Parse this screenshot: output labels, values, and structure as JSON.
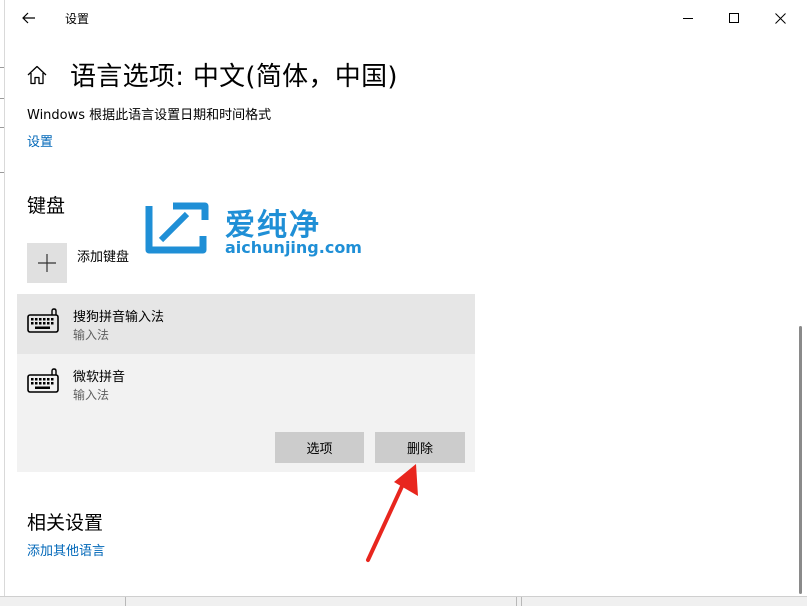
{
  "window": {
    "title": "设置",
    "accent_color": "#0067b8",
    "controls": [
      "minimize-icon",
      "maximize-icon",
      "close-icon"
    ]
  },
  "header": {
    "title": "语言选项: 中文(简体，中国)"
  },
  "region": {
    "description": "Windows 根据此语言设置日期和时间格式",
    "settings_link": "设置"
  },
  "keyboard": {
    "section_title": "键盘",
    "add_label": "添加键盘",
    "items": [
      {
        "name": "搜狗拼音输入法",
        "type": "输入法",
        "icon": "keyboard-icon",
        "selected": true
      },
      {
        "name": "微软拼音",
        "type": "输入法",
        "icon": "keyboard-icon",
        "selected": false
      }
    ],
    "options_label": "选项",
    "delete_label": "删除"
  },
  "related": {
    "section_title": "相关设置",
    "add_language_link": "添加其他语言"
  },
  "watermark": {
    "cn_text": "爱纯净",
    "en_text": "aichunjing.com",
    "color": "#1f8fd6"
  },
  "annotation": {
    "arrow_color": "#e8261e"
  }
}
